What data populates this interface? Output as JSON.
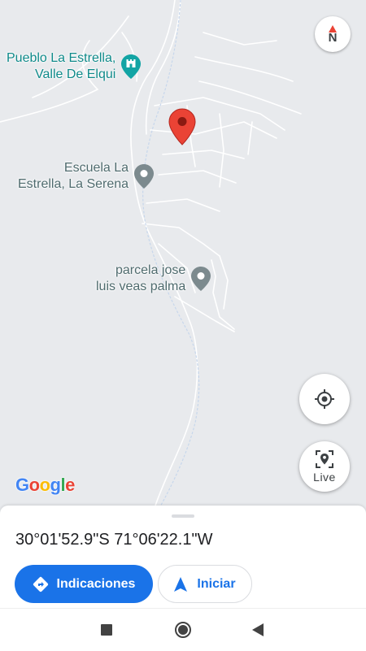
{
  "map": {
    "places": [
      {
        "label_line1": "Pueblo La Estrella,",
        "label_line2": "Valle De Elqui",
        "type": "landmark",
        "icon": "castle-pin-icon"
      },
      {
        "label_line1": "Escuela La",
        "label_line2": "Estrella, La Serena",
        "type": "poi",
        "icon": "location-pin-icon"
      },
      {
        "label_line1": "parcela jose",
        "label_line2": "luis veas palma",
        "type": "poi",
        "icon": "location-pin-icon"
      }
    ],
    "selected_pin": "dropped-pin-icon",
    "compass_label": "N",
    "live_label": "Live",
    "logo_text": "Google"
  },
  "sheet": {
    "coordinates": "30°01'52.9\"S 71°06'22.1\"W",
    "directions_label": "Indicaciones",
    "start_label": "Iniciar"
  },
  "colors": {
    "accent": "#1a73e8",
    "pin_red": "#ea4335",
    "poi_gray": "#7c8a8e",
    "landmark_teal": "#12a4a4"
  },
  "navbar": {
    "icons": [
      "recents-square-icon",
      "home-circle-icon",
      "back-triangle-icon"
    ]
  }
}
